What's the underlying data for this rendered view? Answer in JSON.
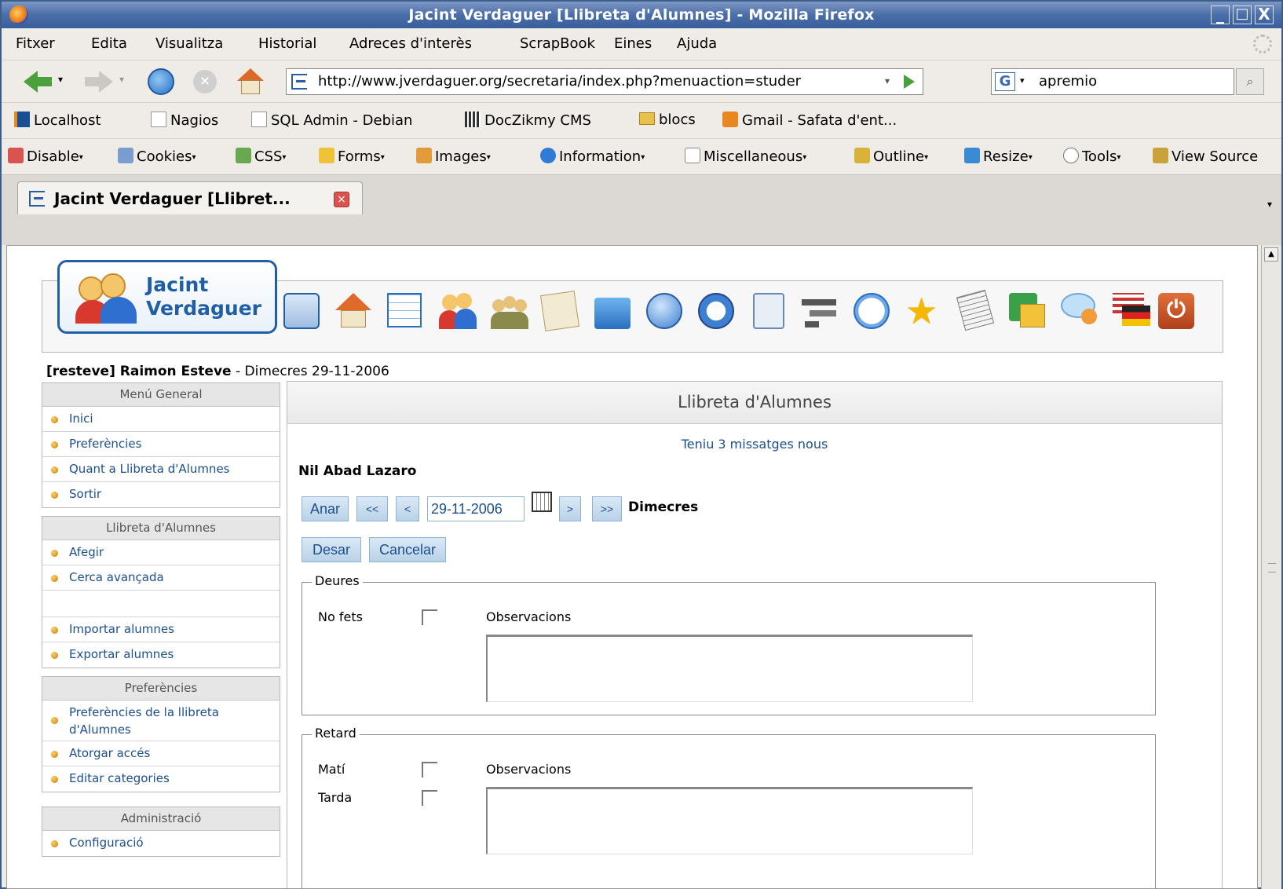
{
  "window": {
    "title": "Jacint Verdaguer [Llibreta d'Alumnes] - Mozilla Firefox",
    "controls": [
      "_",
      "□",
      "X"
    ]
  },
  "menubar": [
    "Fitxer",
    "Edita",
    "Visualitza",
    "Historial",
    "Adreces d'interès",
    "ScrapBook",
    "Eines",
    "Ajuda"
  ],
  "navbar": {
    "url": "http://www.jverdaguer.org/secretaria/index.php?menuaction=studer",
    "search_value": "apremio",
    "search_engine_icon": "G"
  },
  "bookmarks": [
    {
      "label": "Localhost",
      "icon": "localhost-icon",
      "color": "#1b4f93"
    },
    {
      "label": "Nagios",
      "icon": "page-icon",
      "color": "#dddddd"
    },
    {
      "label": "SQL Admin - Debian",
      "icon": "page-icon",
      "color": "#dddddd"
    },
    {
      "label": "DocZikmy CMS",
      "icon": "doc-icon",
      "color": "#333333"
    },
    {
      "label": "blocs",
      "icon": "folder-icon",
      "color": "#e8c04a"
    },
    {
      "label": "Gmail - Safata d'ent...",
      "icon": "feed-icon",
      "color": "#e8861f"
    }
  ],
  "devtoolbar": [
    {
      "label": "Disable",
      "color": "#d9534f"
    },
    {
      "label": "Cookies",
      "color": "#7b9ccf"
    },
    {
      "label": "CSS",
      "color": "#6aa84f"
    },
    {
      "label": "Forms",
      "color": "#f0c23a"
    },
    {
      "label": "Images",
      "color": "#e39b3a"
    },
    {
      "label": "Information",
      "color": "#2f7bd5"
    },
    {
      "label": "Miscellaneous",
      "color": "#888888"
    },
    {
      "label": "Outline",
      "color": "#d9b23a"
    },
    {
      "label": "Resize",
      "color": "#3a8ad5"
    },
    {
      "label": "Tools",
      "color": "#777777"
    },
    {
      "label": "View Source",
      "color": "#c9a23a"
    }
  ],
  "tab": {
    "label": "Jacint Verdaguer [Llibret..."
  },
  "site": {
    "logo_line1": "Jacint",
    "logo_line2": "Verdaguer",
    "user_login": "[resteve] Raimon Esteve",
    "user_date": " - Dimecres 29-11-2006",
    "app_icons": [
      "sitemgr-icon",
      "home-icon",
      "calendar-icon",
      "addressbook-icon",
      "groups-icon",
      "notes-icon",
      "filemanager-icon",
      "browser-icon",
      "safari-icon",
      "tools-icon",
      "projects-icon",
      "clock-icon",
      "star-icon",
      "news-icon",
      "spreadsheet-icon",
      "chat-icon",
      "languages-icon",
      "logout-icon"
    ]
  },
  "sidebar": {
    "sections": [
      {
        "title": "Menú General",
        "items": [
          "Inici",
          "Preferències",
          "Quant a Llibreta d'Alumnes",
          "Sortir"
        ]
      },
      {
        "title": "Llibreta d'Alumnes",
        "items": [
          "Afegir",
          "Cerca avançada",
          "",
          "Importar alumnes",
          "Exportar alumnes"
        ]
      },
      {
        "title": "Preferències",
        "items": [
          "Preferències de la llibreta d'Alumnes",
          "Atorgar accés",
          "Editar categories"
        ]
      },
      {
        "title": "Administració",
        "items": [
          "Configuració"
        ]
      }
    ]
  },
  "main": {
    "title": "Llibreta d'Alumnes",
    "messages": "Teniu 3 missatges nous",
    "student": "Nil Abad Lazaro",
    "buttons": {
      "go": "Anar",
      "first": "<<",
      "prev": "<",
      "next": ">",
      "last": ">>",
      "save": "Desar",
      "cancel": "Cancelar"
    },
    "date": "29-11-2006",
    "day": "Dimecres",
    "homework": {
      "legend": "Deures",
      "not_done": "No fets",
      "observations": "Observacions"
    },
    "late": {
      "legend": "Retard",
      "morning": "Matí",
      "afternoon": "Tarda",
      "observations": "Observacions"
    }
  }
}
